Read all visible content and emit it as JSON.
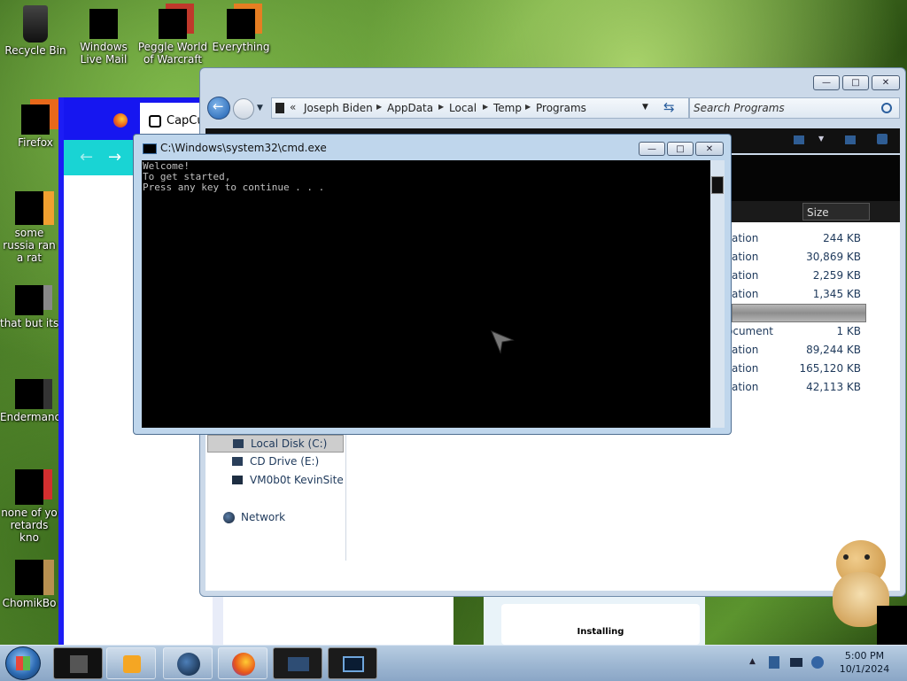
{
  "desktop_icons": [
    {
      "label": "Recycle Bin",
      "icon": "recycle-bin-icon"
    },
    {
      "label": "Windows Live Mail",
      "icon": "mail-icon"
    },
    {
      "label": "Peggle World of Warcraft",
      "icon": "peggle-icon"
    },
    {
      "label": "Everything",
      "icon": "everything-icon"
    },
    {
      "label": "Firefox",
      "icon": "firefox-icon"
    },
    {
      "label": "some russia ran a rat",
      "icon": "app-icon"
    },
    {
      "label": "that but its",
      "icon": "copy-icon"
    },
    {
      "label": "Endermanc",
      "icon": "window-icon"
    },
    {
      "label": "none of yo retards kno",
      "icon": "app-icon"
    },
    {
      "label": "ChomikBo",
      "icon": "hamster-icon"
    }
  ],
  "browser_back": {
    "tab_label": "CapCu"
  },
  "explorer": {
    "breadcrumb": [
      "Joseph Biden",
      "AppData",
      "Local",
      "Temp",
      "Programs"
    ],
    "breadcrumb_prefix": "«",
    "search_placeholder": "Search Programs",
    "size_header": "Size",
    "rows": [
      {
        "type": "ation",
        "size": "244 KB"
      },
      {
        "type": "ation",
        "size": "30,869 KB"
      },
      {
        "type": "ation",
        "size": "2,259 KB"
      },
      {
        "type": "ation",
        "size": "1,345 KB"
      },
      {
        "type": "",
        "size": ""
      },
      {
        "type": "ocument",
        "size": "1 KB"
      },
      {
        "type": "ation",
        "size": "89,244 KB"
      },
      {
        "type": "ation",
        "size": "165,120 KB"
      },
      {
        "type": "ation",
        "size": "42,113 KB"
      }
    ],
    "nav_items": [
      {
        "label": "Local Disk (C:)",
        "icon": "hard-disk-icon"
      },
      {
        "label": "CD Drive (E:)",
        "icon": "cd-drive-icon"
      },
      {
        "label": "VM0b0t KevinSite",
        "icon": "network-drive-icon"
      }
    ],
    "network_label": "Network"
  },
  "cmd": {
    "title": "C:\\Windows\\system32\\cmd.exe",
    "lines": [
      "Welcome!",
      "To get started,",
      "Press any key to continue . . ."
    ]
  },
  "installer": {
    "label": "Installing"
  },
  "taskbar": {
    "time": "5:00 PM",
    "date": "10/1/2024"
  }
}
